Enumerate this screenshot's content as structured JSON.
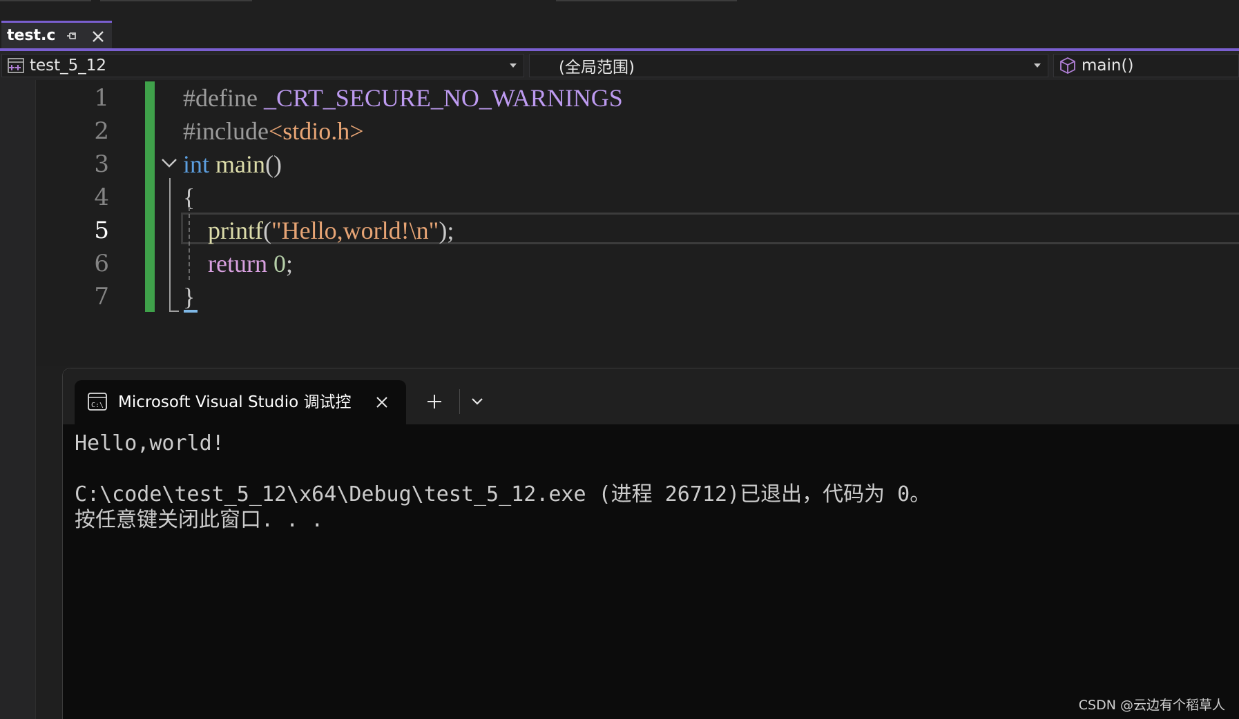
{
  "tabs": {
    "active": {
      "title": "test.c"
    }
  },
  "navbar": {
    "project": "test_5_12",
    "scope": "(全局范围)",
    "member": "main()"
  },
  "editor": {
    "line_numbers": [
      "1",
      "2",
      "3",
      "4",
      "5",
      "6",
      "7"
    ],
    "current_line": "5",
    "lines": [
      {
        "tokens": [
          {
            "t": "#define ",
            "c": "pp"
          },
          {
            "t": "_CRT_SECURE_NO_WARNINGS",
            "c": "macro"
          }
        ]
      },
      {
        "tokens": [
          {
            "t": "#include",
            "c": "pp"
          },
          {
            "t": "<stdio.h>",
            "c": "str"
          }
        ]
      },
      {
        "tokens": [
          {
            "t": "int",
            "c": "kw"
          },
          {
            "t": " ",
            "c": "punc"
          },
          {
            "t": "main",
            "c": "fn"
          },
          {
            "t": "()",
            "c": "punc"
          }
        ]
      },
      {
        "tokens": [
          {
            "t": "{",
            "c": "punc"
          }
        ]
      },
      {
        "tokens": [
          {
            "t": "    ",
            "c": "punc"
          },
          {
            "t": "printf",
            "c": "fn"
          },
          {
            "t": "(",
            "c": "punc"
          },
          {
            "t": "\"Hello,world!\\n\"",
            "c": "str"
          },
          {
            "t": ");",
            "c": "punc"
          }
        ]
      },
      {
        "tokens": [
          {
            "t": "    ",
            "c": "punc"
          },
          {
            "t": "return",
            "c": "ret"
          },
          {
            "t": " ",
            "c": "punc"
          },
          {
            "t": "0",
            "c": "num"
          },
          {
            "t": ";",
            "c": "punc"
          }
        ]
      },
      {
        "tokens": [
          {
            "t": "}",
            "c": "punc"
          }
        ]
      }
    ]
  },
  "terminal": {
    "tab_title": "Microsoft Visual Studio 调试控制台",
    "output": [
      "Hello,world!",
      "",
      "C:\\code\\test_5_12\\x64\\Debug\\test_5_12.exe (进程 26712)已退出，代码为 0。",
      "按任意键关闭此窗口. . ."
    ]
  },
  "watermark": "CSDN @云边有个稻草人",
  "colors": {
    "accent": "#7a5fd0",
    "change_bar": "#3fa14a",
    "keyword": "#5c9fe0",
    "function": "#dcdcaa",
    "string": "#e8a575",
    "macro": "#bd9af0",
    "control_keyword": "#d8a0df",
    "number": "#b5cea8"
  },
  "icons": {
    "project": "cpp-project-icon",
    "member": "function-cube-icon",
    "terminal": "console-icon"
  }
}
